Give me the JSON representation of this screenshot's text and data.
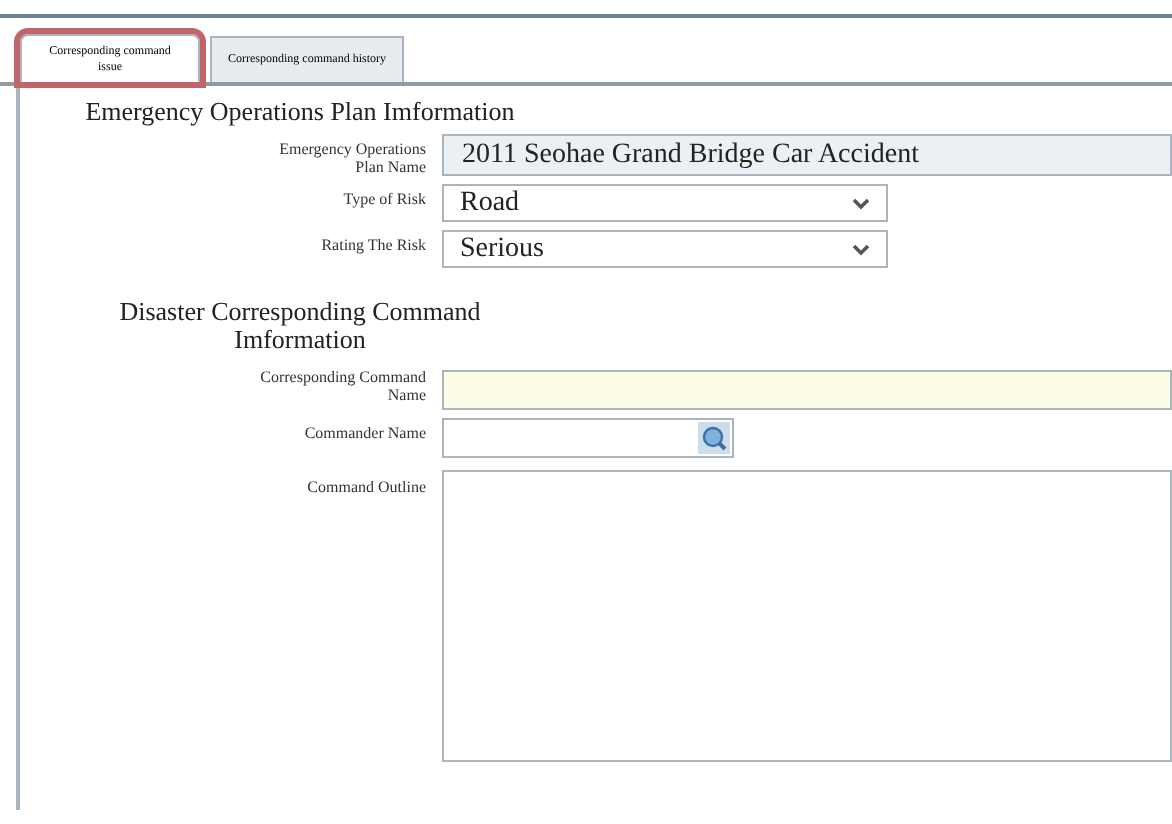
{
  "tabs": [
    {
      "label": "Corresponding command issue",
      "selected": true
    },
    {
      "label": "Corresponding command history",
      "selected": false
    }
  ],
  "sections": [
    {
      "title": "Emergency Operations Plan Imformation",
      "fields": [
        {
          "kind": "readonly",
          "label": "Emergency Operations Plan Name",
          "value": "2011 Seohae Grand Bridge Car Accident"
        },
        {
          "kind": "select",
          "label": "Type of Risk",
          "value": "Road"
        },
        {
          "kind": "select",
          "label": "Rating The Risk",
          "value": "Serious"
        }
      ]
    },
    {
      "title": "Disaster Corresponding Command Imformation",
      "fields": [
        {
          "kind": "required",
          "label": "Corresponding Command Name"
        },
        {
          "kind": "lookup",
          "label": "Commander Name"
        },
        {
          "kind": "textarea",
          "label": "Command Outline"
        }
      ]
    }
  ]
}
